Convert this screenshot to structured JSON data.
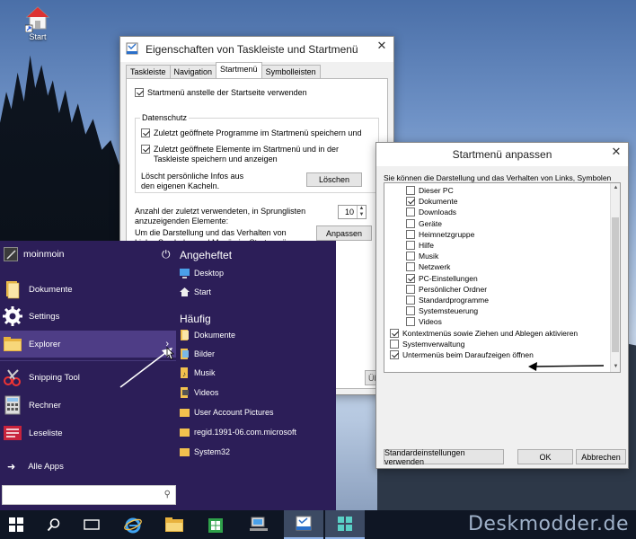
{
  "desktop": {
    "icon_label": "Start",
    "watermark": "Deskmodder.de"
  },
  "props_dialog": {
    "title": "Eigenschaften von Taskleiste und Startmenü",
    "tabs": [
      "Taskleiste",
      "Navigation",
      "Startmenü",
      "Symbolleisten"
    ],
    "active_tab": "Startmenü",
    "use_startmenu": "Startmenü anstelle der Startseite verwenden",
    "privacy_group": "Datenschutz",
    "recent_programs": "Zuletzt geöffnete Programme im Startmenü speichern und",
    "recent_items": "Zuletzt geöffnete Elemente im Startmenü und in der Taskleiste speichern und anzeigen",
    "clear_info": "Löscht persönliche Infos aus den eigenen Kacheln.",
    "clear_button": "Löschen",
    "jumplist_label": "Anzahl der zuletzt verwendeten, in Sprunglisten anzuzeigenden Elemente:",
    "jumplist_value": "10",
    "customize_label": "Um die Darstellung und das Verhalten von Links, Symbolen und Menüs im Startmenü anzupassen,",
    "customize_button": "Anpassen",
    "apply_button_partial": "Übernehr"
  },
  "customize_dialog": {
    "title": "Startmenü anpassen",
    "description": "Sie können die Darstellung und das Verhalten von Links, Symbolen und Menüs im Startmenü anpassen.",
    "items": [
      {
        "label": "Dieser PC",
        "checked": false,
        "indent": 1
      },
      {
        "label": "Dokumente",
        "checked": true,
        "indent": 1
      },
      {
        "label": "Downloads",
        "checked": false,
        "indent": 1
      },
      {
        "label": "Geräte",
        "checked": false,
        "indent": 1
      },
      {
        "label": "Heimnetzgruppe",
        "checked": false,
        "indent": 1
      },
      {
        "label": "Hilfe",
        "checked": false,
        "indent": 1
      },
      {
        "label": "Musik",
        "checked": false,
        "indent": 1
      },
      {
        "label": "Netzwerk",
        "checked": false,
        "indent": 1
      },
      {
        "label": "PC-Einstellungen",
        "checked": true,
        "indent": 1
      },
      {
        "label": "Persönlicher Ordner",
        "checked": false,
        "indent": 1
      },
      {
        "label": "Standardprogramme",
        "checked": false,
        "indent": 1
      },
      {
        "label": "Systemsteuerung",
        "checked": false,
        "indent": 1
      },
      {
        "label": "Videos",
        "checked": false,
        "indent": 1
      },
      {
        "label": "Kontextmenüs sowie Ziehen und Ablegen aktivieren",
        "checked": true,
        "indent": 0
      },
      {
        "label": "Systemverwaltung",
        "checked": false,
        "indent": 0
      },
      {
        "label": "Untermenüs beim Daraufzeigen öffnen",
        "checked": true,
        "indent": 0
      }
    ],
    "defaults_button": "Standardeinstellungen verwenden",
    "ok_button": "OK",
    "cancel_button": "Abbrechen"
  },
  "start_menu": {
    "user": "moinmoin",
    "left_items": [
      "Dokumente",
      "Settings",
      "Explorer",
      "Snipping Tool",
      "Rechner",
      "Leseliste"
    ],
    "all_apps": "Alle Apps",
    "pinned_header": "Angeheftet",
    "pinned": [
      "Desktop",
      "Start"
    ],
    "frequent_header": "Häufig",
    "frequent": [
      "Dokumente",
      "Bilder",
      "Musik",
      "Videos",
      "User Account Pictures",
      "regid.1991-06.com.microsoft",
      "System32"
    ],
    "search_placeholder": ""
  },
  "colors": {
    "start_bg": "#2c1e58",
    "start_hover": "#4e3d86",
    "taskbar": "#0f1624",
    "folder": "#f2c14e"
  }
}
